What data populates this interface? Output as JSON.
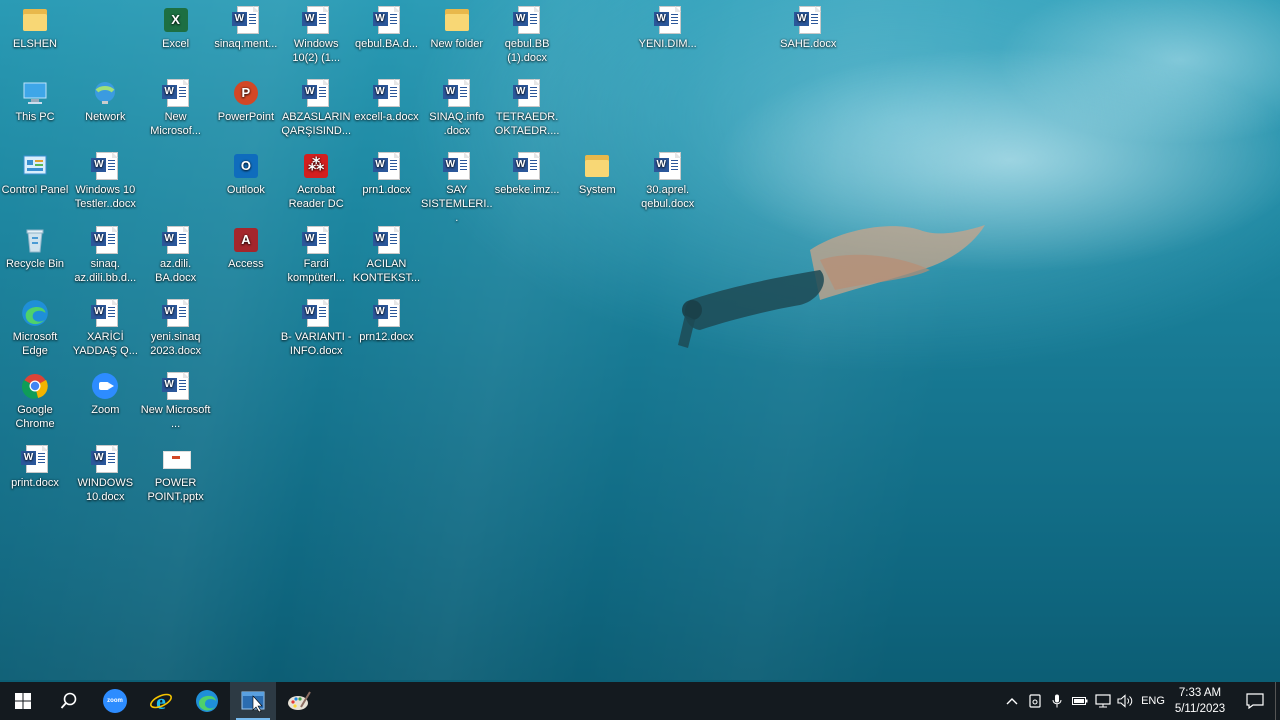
{
  "desktop": {
    "icons": [
      {
        "label": "ELSHEN",
        "type": "folder"
      },
      {
        "label": "Excel",
        "type": "excel"
      },
      {
        "label": "sinaq.ment...",
        "type": "word"
      },
      {
        "label": "Windows 10(2) (1...",
        "type": "word"
      },
      {
        "label": "qebul.BA.d...",
        "type": "word"
      },
      {
        "label": "New folder",
        "type": "folder"
      },
      {
        "label": "qebul.BB (1).docx",
        "type": "word"
      },
      {
        "label": "YENI.DIM...",
        "type": "word"
      },
      {
        "label": "SAHE.docx",
        "type": "word"
      },
      {
        "label": "This PC",
        "type": "thispc"
      },
      {
        "label": "Network",
        "type": "network"
      },
      {
        "label": "New Microsof...",
        "type": "word"
      },
      {
        "label": "PowerPoint",
        "type": "powerpoint"
      },
      {
        "label": "ABZASLARIN QARŞISIND...",
        "type": "word"
      },
      {
        "label": "excell-a.docx",
        "type": "word"
      },
      {
        "label": "SINAQ.info .docx",
        "type": "word"
      },
      {
        "label": "TETRAEDR. OKTAEDR....",
        "type": "word"
      },
      {
        "label": "Control Panel",
        "type": "controlpanel"
      },
      {
        "label": "Windows 10 Testler..docx",
        "type": "word"
      },
      {
        "label": "Outlook",
        "type": "outlook"
      },
      {
        "label": "Acrobat Reader DC",
        "type": "acrobat"
      },
      {
        "label": "prn1.docx",
        "type": "word"
      },
      {
        "label": "SAY SISTEMLERI...",
        "type": "word"
      },
      {
        "label": "sebeke.imz...",
        "type": "word"
      },
      {
        "label": "System",
        "type": "folder"
      },
      {
        "label": "30.aprel. qebul.docx",
        "type": "word"
      },
      {
        "label": "Recycle Bin",
        "type": "recycle"
      },
      {
        "label": "sinaq. az.dili.bb.d...",
        "type": "word"
      },
      {
        "label": "az.dili. BA.docx",
        "type": "word"
      },
      {
        "label": "Access",
        "type": "access"
      },
      {
        "label": "Fardi kompüterl...",
        "type": "word"
      },
      {
        "label": "ACILAN KONTEKST...",
        "type": "word"
      },
      {
        "label": "Microsoft Edge",
        "type": "edge"
      },
      {
        "label": "XARİCİ YADDAŞ Q...",
        "type": "word"
      },
      {
        "label": "yeni.sinaq 2023.docx",
        "type": "word"
      },
      {
        "label": "B- VARIANTI -INFO.docx",
        "type": "word"
      },
      {
        "label": "prn12.docx",
        "type": "word"
      },
      {
        "label": "Google Chrome",
        "type": "chrome"
      },
      {
        "label": "Zoom",
        "type": "zoom"
      },
      {
        "label": "New Microsoft ...",
        "type": "word"
      },
      {
        "label": "print.docx",
        "type": "word"
      },
      {
        "label": "WINDOWS 10.docx",
        "type": "word"
      },
      {
        "label": "POWER POINT.pptx",
        "type": "pptx"
      }
    ]
  },
  "taskbar": {
    "zoom_badge": "zoom",
    "language": "ENG",
    "time": "7:33 AM",
    "date": "5/11/2023"
  },
  "colors": {
    "taskbar": "#141a1f",
    "word_blue": "#2b579a",
    "accent": "#76b9ed"
  }
}
